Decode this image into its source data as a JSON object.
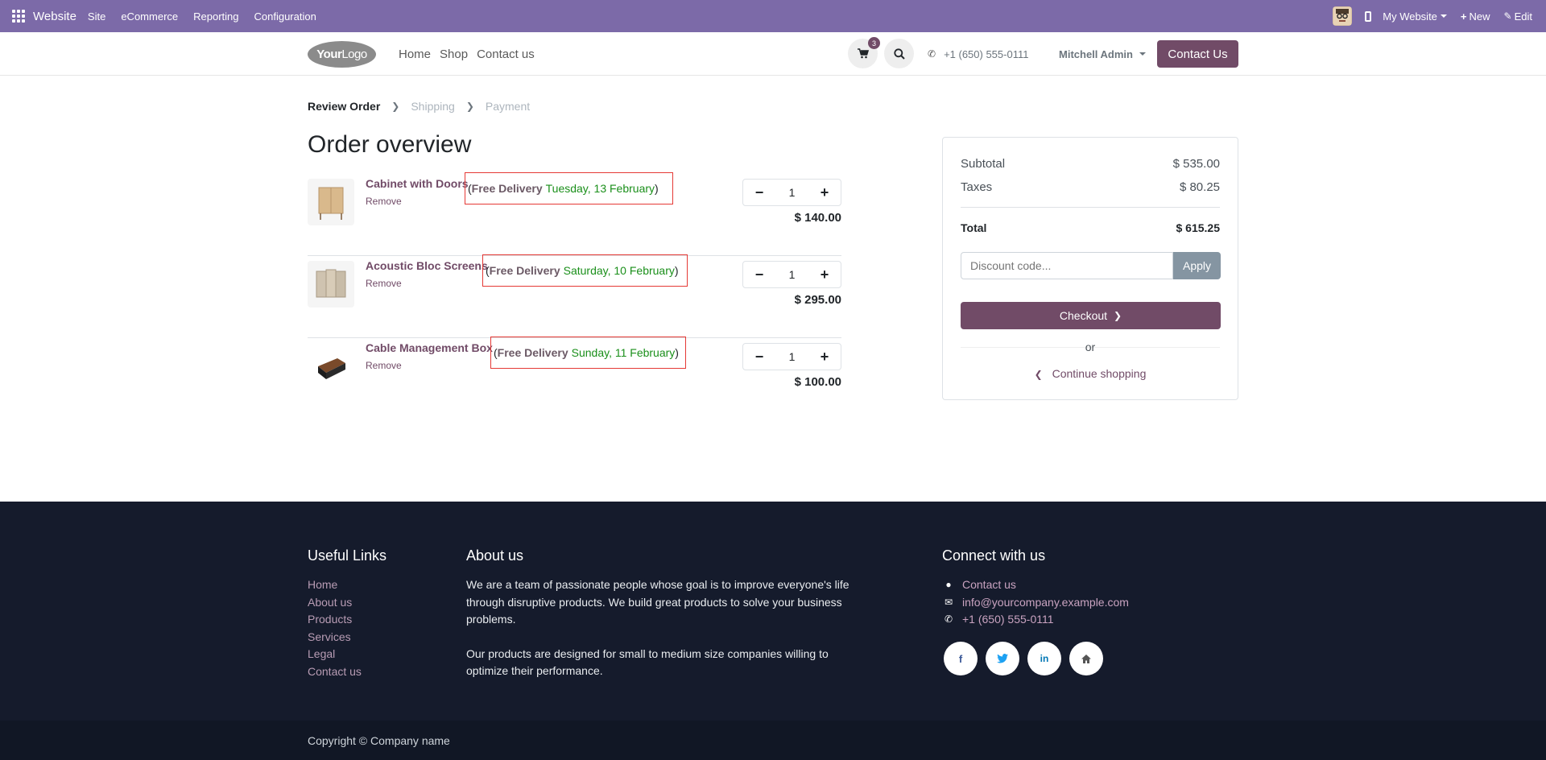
{
  "admin_bar": {
    "brand": "Website",
    "menu": [
      "Site",
      "eCommerce",
      "Reporting",
      "Configuration"
    ],
    "website_switcher": "My Website",
    "new_label": "New",
    "edit_label": "Edit"
  },
  "header": {
    "logo_text_bold": "Your",
    "logo_text_thin": "Logo",
    "nav": [
      "Home",
      "Shop",
      "Contact us"
    ],
    "cart_count": "3",
    "phone": "+1 (650) 555-0111",
    "user": "Mitchell Admin",
    "contact_button": "Contact Us"
  },
  "breadcrumb": {
    "steps": [
      "Review Order",
      "Shipping",
      "Payment"
    ]
  },
  "page_title": "Order overview",
  "lines": [
    {
      "name": "Cabinet with Doors",
      "remove": "Remove",
      "delivery_label": "Free Delivery",
      "delivery_date": "Tuesday, 13 February",
      "qty": "1",
      "price": "$ 140.00"
    },
    {
      "name": "Acoustic Bloc Screens",
      "remove": "Remove",
      "delivery_label": "Free Delivery",
      "delivery_date": "Saturday, 10 February",
      "qty": "1",
      "price": "$ 295.00"
    },
    {
      "name": "Cable Management Box",
      "remove": "Remove",
      "delivery_label": "Free Delivery",
      "delivery_date": "Sunday, 11 February",
      "qty": "1",
      "price": "$ 100.00"
    }
  ],
  "summary": {
    "subtotal_label": "Subtotal",
    "subtotal": "$ 535.00",
    "taxes_label": "Taxes",
    "taxes": "$ 80.25",
    "total_label": "Total",
    "total": "$ 615.25",
    "discount_placeholder": "Discount code...",
    "apply": "Apply",
    "checkout": "Checkout",
    "or": "or",
    "continue": "Continue shopping"
  },
  "footer": {
    "useful_links_title": "Useful Links",
    "useful_links": [
      "Home",
      "About us",
      "Products",
      "Services",
      "Legal",
      "Contact us"
    ],
    "about_title": "About us",
    "about_p1": "We are a team of passionate people whose goal is to improve everyone's life through disruptive products. We build great products to solve your business problems.",
    "about_p2": "Our products are designed for small to medium size companies willing to optimize their performance.",
    "connect_title": "Connect with us",
    "connect_contact": "Contact us",
    "connect_email": "info@yourcompany.example.com",
    "connect_phone": "+1 (650) 555-0111",
    "social_icons": [
      "facebook-icon",
      "twitter-icon",
      "linkedin-icon",
      "home-icon"
    ],
    "copyright": "Copyright © Company name"
  },
  "colors": {
    "admin_bar": "#7c6aa8",
    "brand": "#714b67",
    "delivery_date": "#1a8f1a",
    "highlight_border": "#e53935",
    "footer": "#151b2c"
  }
}
